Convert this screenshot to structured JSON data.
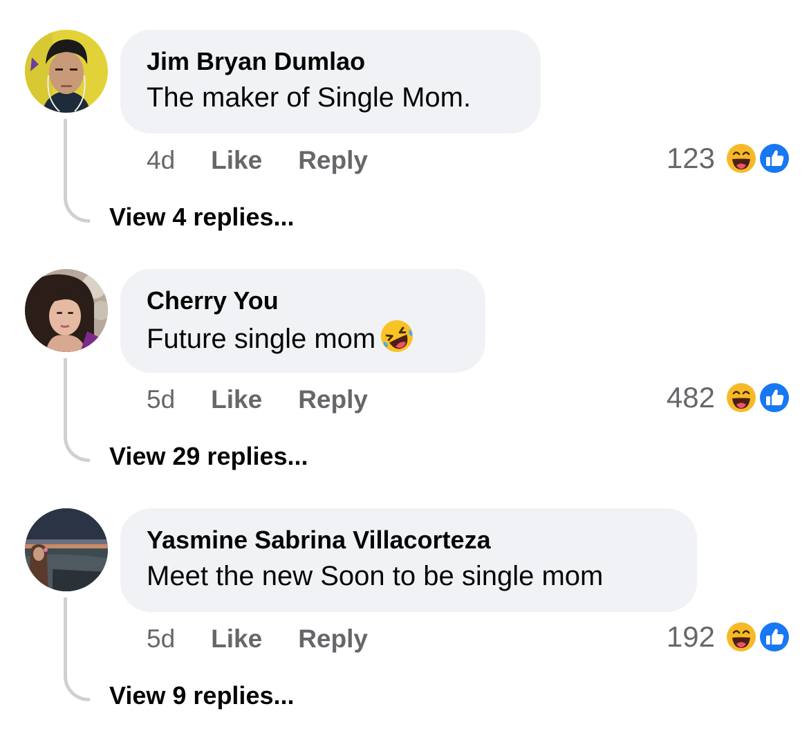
{
  "comments": [
    {
      "author": "Jim Bryan Dumlao",
      "text": "The maker of Single Mom.",
      "age": "4d",
      "like_label": "Like",
      "reply_label": "Reply",
      "reaction_count": "123",
      "reaction_icons": [
        "haha-icon",
        "like-icon"
      ],
      "view_replies": "View 4 replies..."
    },
    {
      "author": "Cherry You",
      "text": "Future single mom",
      "text_emoji": "rolling-on-floor-laughing-icon",
      "age": "5d",
      "like_label": "Like",
      "reply_label": "Reply",
      "reaction_count": "482",
      "reaction_icons": [
        "haha-icon",
        "like-icon"
      ],
      "view_replies": "View 29 replies..."
    },
    {
      "author": "Yasmine Sabrina Villacorteza",
      "text": "Meet the new Soon to be single mom",
      "age": "5d",
      "like_label": "Like",
      "reply_label": "Reply",
      "reaction_count": "192",
      "reaction_icons": [
        "haha-icon",
        "like-icon"
      ],
      "view_replies": "View 9 replies..."
    }
  ],
  "colors": {
    "bubble": "#f0f2f5",
    "meta_text": "#65676b",
    "primary_text": "#050505",
    "like_blue": "#1877f2",
    "haha_yellow": "#f7b928"
  }
}
